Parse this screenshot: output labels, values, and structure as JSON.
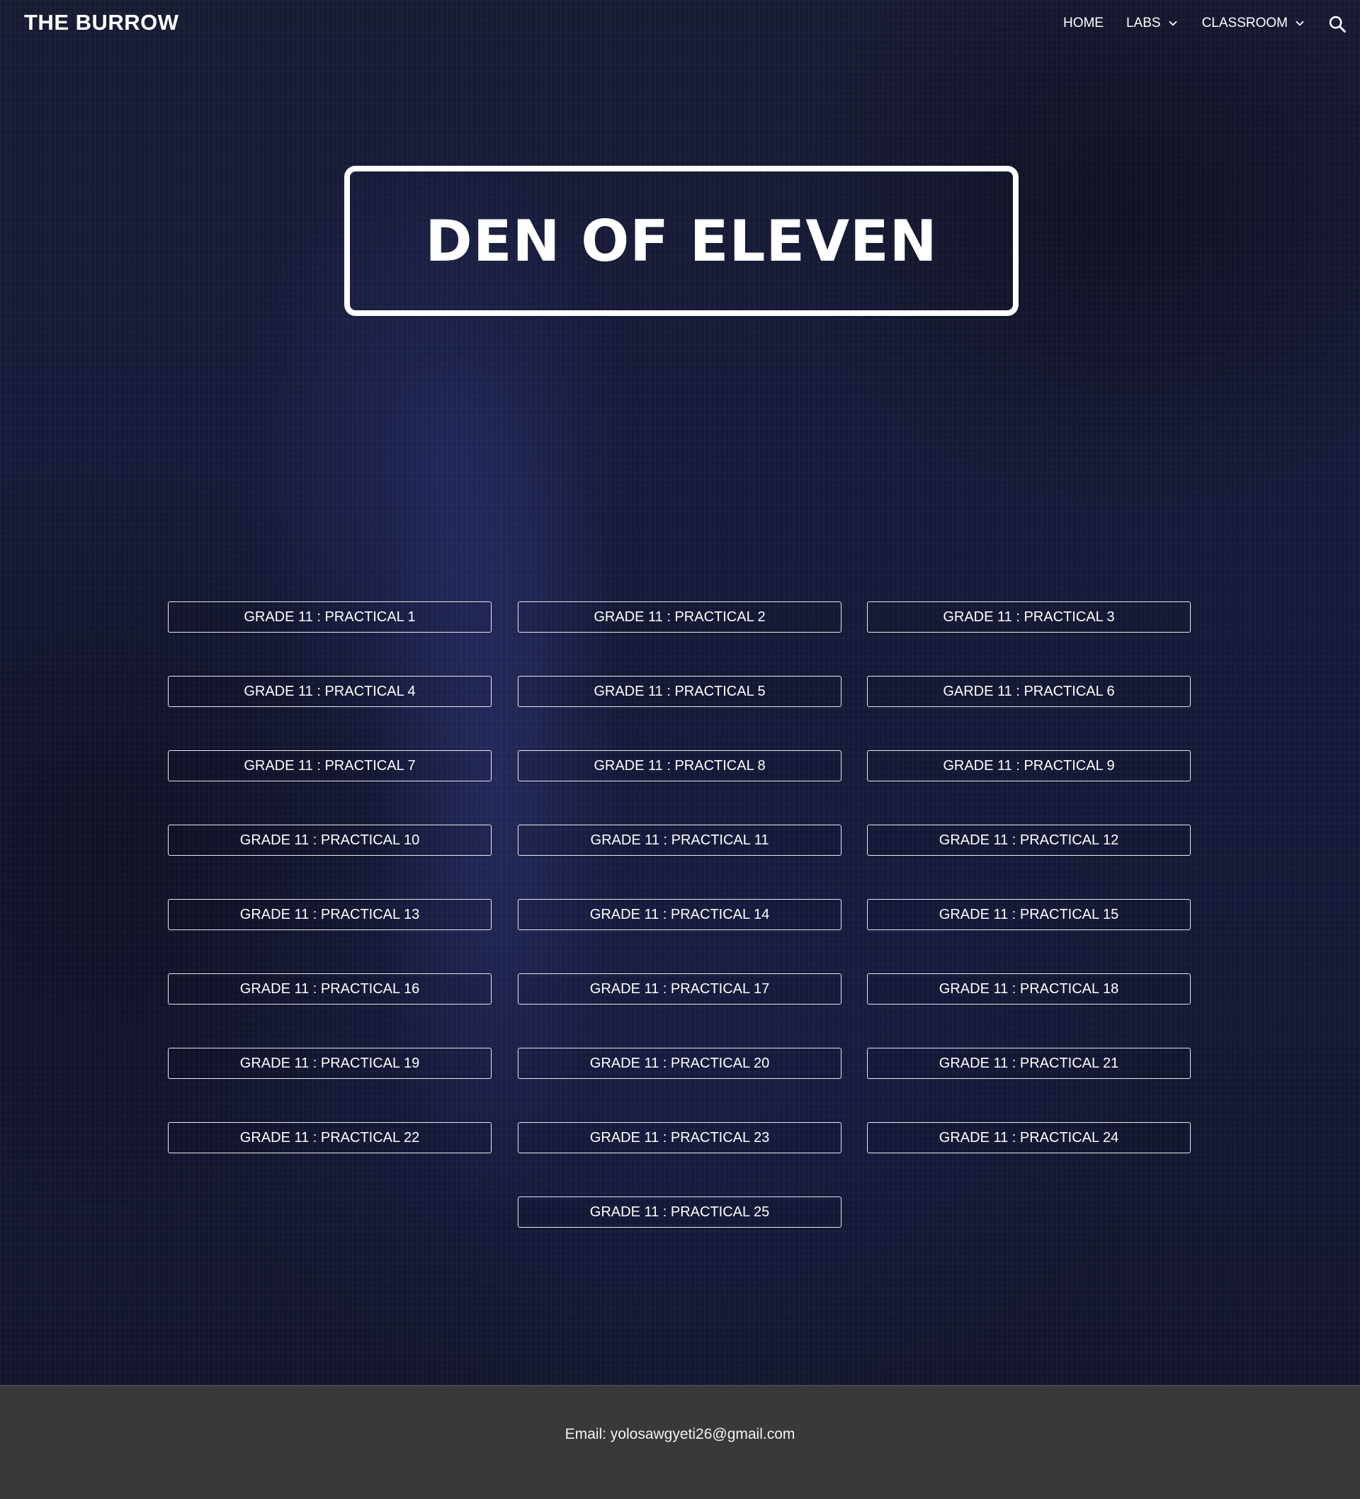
{
  "header": {
    "brand": "THE BURROW",
    "nav": [
      {
        "label": "HOME",
        "has_dropdown": false
      },
      {
        "label": "LABS",
        "has_dropdown": true
      },
      {
        "label": "CLASSROOM",
        "has_dropdown": true
      }
    ],
    "search_icon": "search-icon"
  },
  "main": {
    "title": "DEN OF ELEVEN",
    "buttons": [
      "GRADE 11 : PRACTICAL 1",
      "GRADE 11 : PRACTICAL 2",
      "GRADE 11 : PRACTICAL 3",
      "GRADE 11 : PRACTICAL 4",
      "GRADE 11 : PRACTICAL 5",
      "GARDE 11 : PRACTICAL 6",
      "GRADE 11 : PRACTICAL 7",
      "GRADE 11 : PRACTICAL 8",
      "GRADE 11 : PRACTICAL 9",
      "GRADE 11 : PRACTICAL 10",
      "GRADE 11 : PRACTICAL 11",
      "GRADE 11 : PRACTICAL 12",
      "GRADE 11 : PRACTICAL 13",
      "GRADE 11 : PRACTICAL 14",
      "GRADE 11 : PRACTICAL 15",
      "GRADE 11 : PRACTICAL 16",
      "GRADE 11 : PRACTICAL 17",
      "GRADE 11 : PRACTICAL 18",
      "GRADE 11 : PRACTICAL 19",
      "GRADE 11 : PRACTICAL 20",
      "GRADE 11 : PRACTICAL 21",
      "GRADE 11 : PRACTICAL 22",
      "GRADE 11 : PRACTICAL 23",
      "GRADE 11 : PRACTICAL 24",
      "GRADE 11 : PRACTICAL 25"
    ]
  },
  "footer": {
    "email_text": "Email: yolosawgyeti26@gmail.com"
  },
  "colors": {
    "background": "#161a38",
    "footer": "#393939",
    "text": "#ffffff"
  }
}
